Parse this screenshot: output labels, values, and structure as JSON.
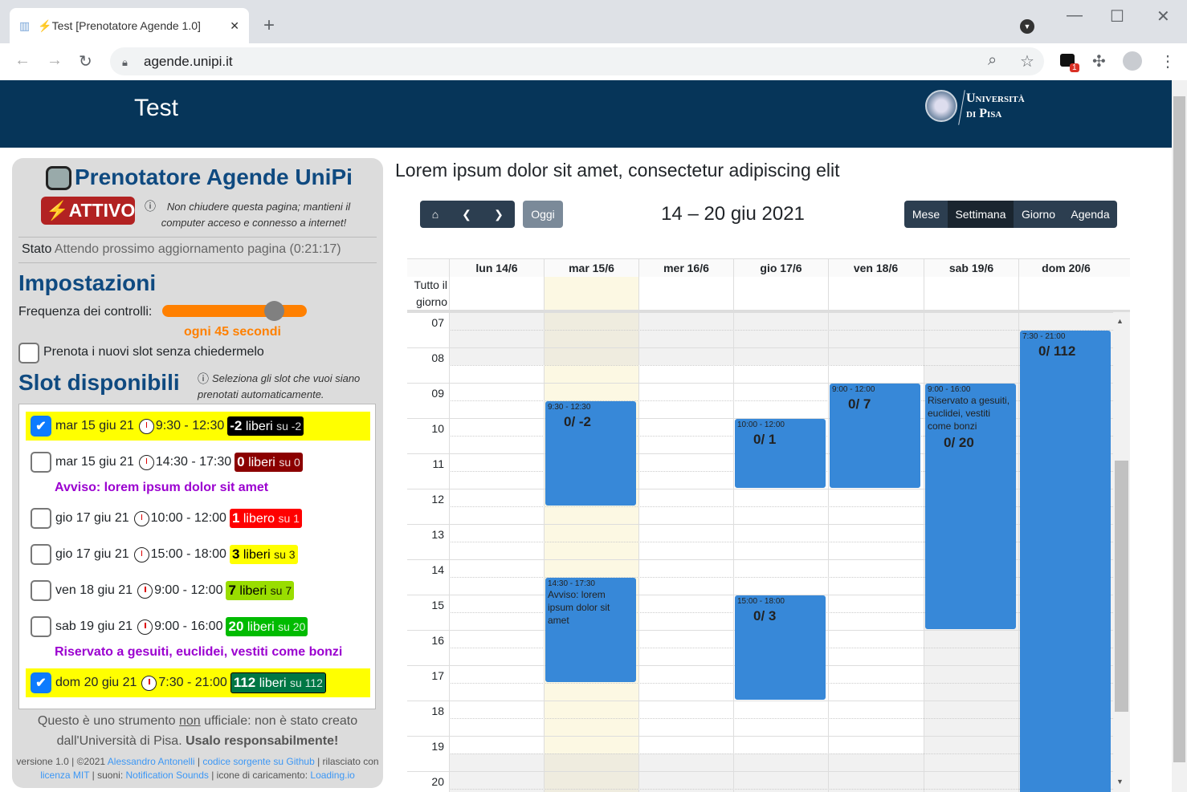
{
  "browser": {
    "tab_title": "Test [Prenotatore Agende 1.0]",
    "url": "agende.unipi.it",
    "ext_badge": "1"
  },
  "header": {
    "title": "Test",
    "logo_line1": "Università",
    "logo_line2": "di Pisa"
  },
  "panel": {
    "app_title": "Prenotatore Agende UniPi",
    "status_badge": "ATTIVO",
    "keep_open_note": "Non chiudere questa pagina; mantieni il computer acceso e connesso a internet!",
    "state_label": "Stato",
    "state_value": "Attendo prossimo aggiornamento pagina (0:21:17)",
    "settings_title": "Impostazioni",
    "frequency_label": "Frequenza dei controlli:",
    "frequency_slider_fraction": 0.8,
    "frequency_value": "ogni 45 secondi",
    "auto_book_label": "Prenota i nuovi slot senza chiedermelo",
    "auto_book_checked": false,
    "slots_title": "Slot disponibili",
    "slots_note": "Seleziona gli slot che vuoi siano prenotati automaticamente.",
    "slots": [
      {
        "date": "mar 15 giu 21",
        "time": "9:30 - 12:30",
        "free": "-2",
        "word": "liberi",
        "total": "su -2",
        "checked": true,
        "color": "#000000",
        "fg": "#ffffff"
      },
      {
        "date": "mar 15 giu 21",
        "time": "14:30 - 17:30",
        "free": "0",
        "word": "liberi",
        "total": "su 0",
        "checked": false,
        "color": "#8b0000",
        "fg": "#ffffff",
        "warning": "Avviso: lorem ipsum dolor sit amet"
      },
      {
        "date": "gio 17 giu 21",
        "time": "10:00 - 12:00",
        "free": "1",
        "word": "libero",
        "total": "su 1",
        "checked": false,
        "color": "#ff0000",
        "fg": "#ffffff"
      },
      {
        "date": "gio 17 giu 21",
        "time": "15:00 - 18:00",
        "free": "3",
        "word": "liberi",
        "total": "su 3",
        "checked": false,
        "color": "#ffff00",
        "fg": "#000000"
      },
      {
        "date": "ven 18 giu 21",
        "time": "9:00 - 12:00",
        "free": "7",
        "word": "liberi",
        "total": "su 7",
        "checked": false,
        "color": "#99dd00",
        "fg": "#000000"
      },
      {
        "date": "sab 19 giu 21",
        "time": "9:00 - 16:00",
        "free": "20",
        "word": "liberi",
        "total": "su 20",
        "checked": false,
        "color": "#00bb00",
        "fg": "#ffffff",
        "warning": "Riservato a gesuiti, euclidei, vestiti come bonzi"
      },
      {
        "date": "dom 20 giu 21",
        "time": "7:30 - 21:00",
        "free": "112",
        "word": "liberi",
        "total": "su 112",
        "checked": true,
        "color": "#007744",
        "fg": "#ffffff"
      }
    ],
    "disclaimer_a": "Questo è uno strumento ",
    "disclaimer_non": "non",
    "disclaimer_b": " ufficiale: non è stato creato dall'Università di Pisa. ",
    "disclaimer_bold": "Usalo responsabilmente!",
    "footer": {
      "version": "versione 1.0 | ©2021 ",
      "author": "Alessandro Antonelli",
      "sep1": " | ",
      "source": "codice sorgente su Github",
      "released": " | rilasciato con ",
      "license": "licenza MIT",
      "sounds": " | suoni: ",
      "sounds_link": "Notification Sounds",
      "icons": " | icone di caricamento: ",
      "icons_link": "Loading.io"
    }
  },
  "calendar": {
    "heading": "Lorem ipsum dolor sit amet, consectetur adipiscing elit",
    "today_label": "Oggi",
    "range": "14 – 20 giu 2021",
    "views": [
      "Mese",
      "Settimana",
      "Giorno",
      "Agenda"
    ],
    "active_view": "Settimana",
    "all_day_label": "Tutto il giorno",
    "days": [
      "lun 14/6",
      "mar 15/6",
      "mer 16/6",
      "gio 17/6",
      "ven 18/6",
      "sab 19/6",
      "dom 20/6"
    ],
    "today_index": 1,
    "hours": [
      "07",
      "08",
      "09",
      "10",
      "11",
      "12",
      "13",
      "14",
      "15",
      "16",
      "17",
      "18",
      "19",
      "20"
    ],
    "events": [
      {
        "day": 1,
        "start": 9.5,
        "end": 12.5,
        "time": "9:30 - 12:30",
        "count": "0/ -2"
      },
      {
        "day": 1,
        "start": 14.5,
        "end": 17.5,
        "time": "14:30 - 17:30",
        "desc": "Avviso: lorem ipsum dolor sit amet"
      },
      {
        "day": 3,
        "start": 10,
        "end": 12,
        "time": "10:00 - 12:00",
        "count": "0/ 1"
      },
      {
        "day": 3,
        "start": 15,
        "end": 18,
        "time": "15:00 - 18:00",
        "count": "0/ 3"
      },
      {
        "day": 4,
        "start": 9,
        "end": 12,
        "time": "9:00 - 12:00",
        "count": "0/ 7"
      },
      {
        "day": 5,
        "start": 9,
        "end": 16,
        "time": "9:00 - 16:00",
        "desc": "Riservato a gesuiti, euclidei, vestiti come bonzi",
        "count": "0/ 20"
      },
      {
        "day": 6,
        "start": 7.5,
        "end": 21,
        "time": "7:30 - 21:00",
        "count": "0/ 112"
      }
    ]
  }
}
